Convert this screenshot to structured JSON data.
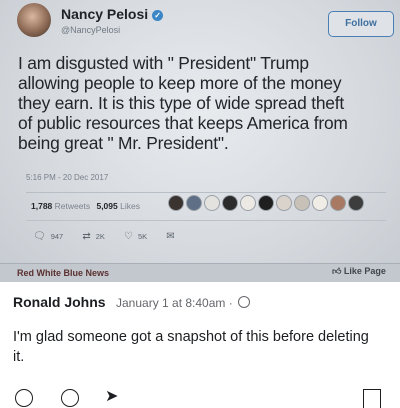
{
  "tweet": {
    "display_name": "Nancy Pelosi",
    "handle": "@NancyPelosi",
    "follow_label": "Follow",
    "lines": [
      "I am disgusted with \" President\" Trump",
      "allowing people to keep more of the money",
      "they earn.  It is this type of wide spread theft",
      "of public resources that keeps America from",
      "being great \" Mr. President\"."
    ],
    "timestamp": "5:16 PM - 20 Dec 2017",
    "retweets_count": "1,788",
    "retweets_label": "Retweets",
    "likes_count": "5,095",
    "likes_label": "Likes",
    "reply_count": "947",
    "retweet_action_count": "2K",
    "like_action_count": "5K",
    "icons": [
      "reply-icon",
      "retweet-icon",
      "heart-icon",
      "dm-icon"
    ]
  },
  "screen_footer": {
    "left_label": "Red White Blue News",
    "right_label": "Like Page"
  },
  "post": {
    "author": "Ronald Johns",
    "date": "January 1 at 8:40am",
    "separator": "·",
    "text": "I'm glad someone got a snapshot of this before deleting it."
  },
  "colors": {
    "link_blue": "#3b86c7",
    "text_dark": "#1c1e21",
    "meta_gray": "#65676b"
  }
}
